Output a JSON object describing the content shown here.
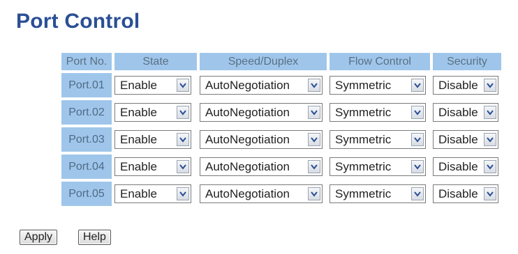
{
  "page": {
    "title": "Port Control"
  },
  "table": {
    "headers": [
      "Port No.",
      "State",
      "Speed/Duplex",
      "Flow Control",
      "Security"
    ],
    "rows": [
      {
        "port": "Port.01",
        "state": "Enable",
        "speed": "AutoNegotiation",
        "flow": "Symmetric",
        "security": "Disable"
      },
      {
        "port": "Port.02",
        "state": "Enable",
        "speed": "AutoNegotiation",
        "flow": "Symmetric",
        "security": "Disable"
      },
      {
        "port": "Port.03",
        "state": "Enable",
        "speed": "AutoNegotiation",
        "flow": "Symmetric",
        "security": "Disable"
      },
      {
        "port": "Port.04",
        "state": "Enable",
        "speed": "AutoNegotiation",
        "flow": "Symmetric",
        "security": "Disable"
      },
      {
        "port": "Port.05",
        "state": "Enable",
        "speed": "AutoNegotiation",
        "flow": "Symmetric",
        "security": "Disable"
      }
    ]
  },
  "buttons": {
    "apply": "Apply",
    "help": "Help"
  },
  "icons": {
    "dropdown": "chevron-down-icon"
  },
  "colors": {
    "title": "#2b4f95",
    "header_bg": "#9fc6ea",
    "header_text": "#5a6f86"
  }
}
